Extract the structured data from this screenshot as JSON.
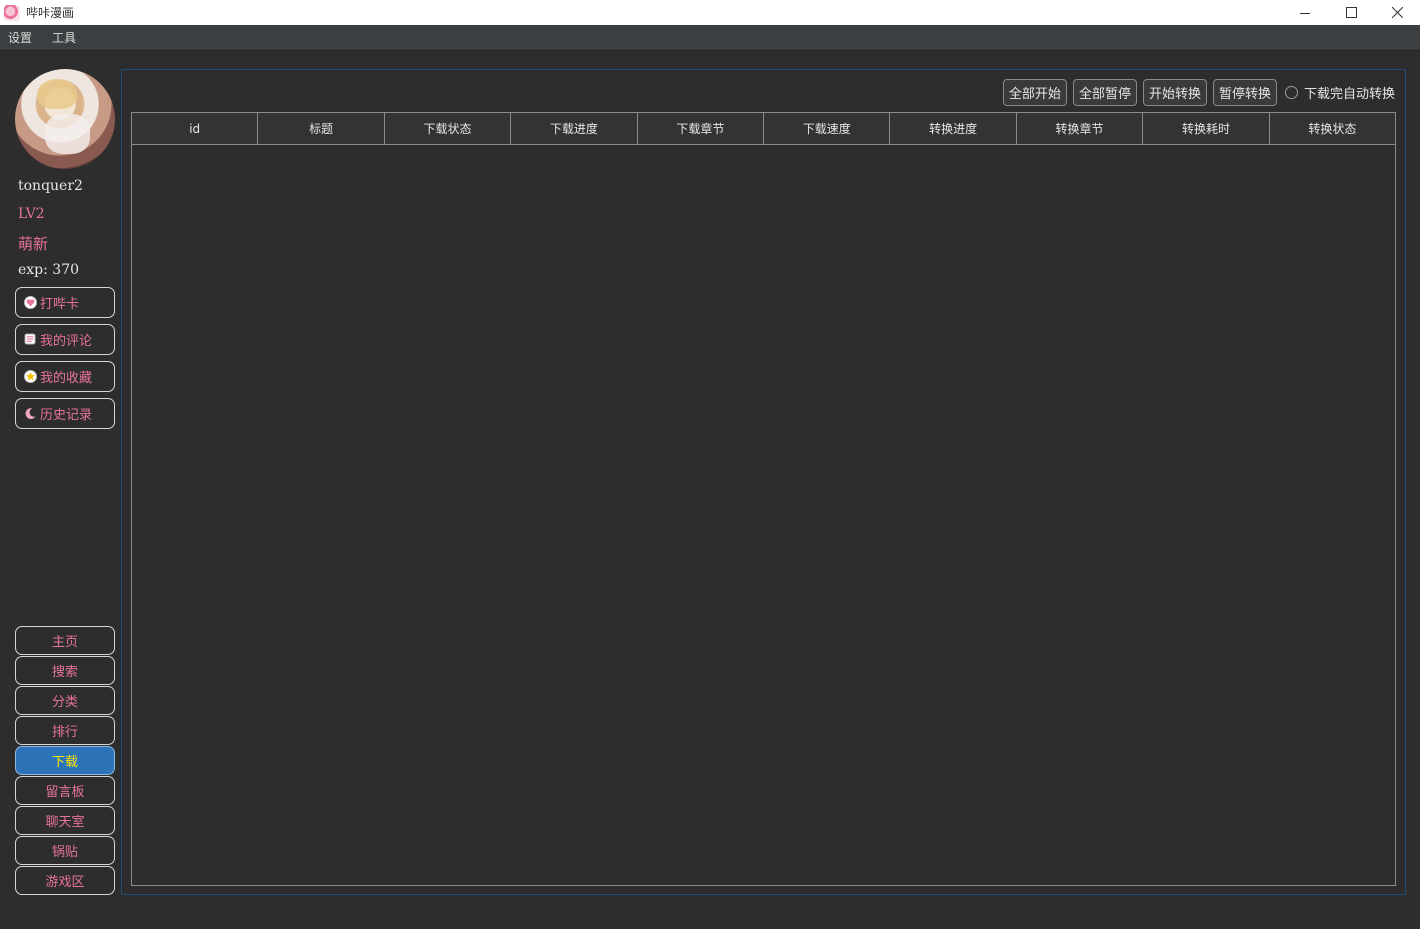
{
  "window": {
    "title": "哔咔漫画"
  },
  "menubar": {
    "items": [
      "设置",
      "工具"
    ]
  },
  "user": {
    "name": "tonquer2",
    "level": "LV2",
    "title": "萌新",
    "exp": "exp: 370"
  },
  "user_actions": [
    {
      "label": "打哔卡",
      "icon": "heart-icon"
    },
    {
      "label": "我的评论",
      "icon": "comment-icon"
    },
    {
      "label": "我的收藏",
      "icon": "star-icon"
    },
    {
      "label": "历史记录",
      "icon": "moon-icon"
    }
  ],
  "nav": [
    {
      "label": "主页"
    },
    {
      "label": "搜索"
    },
    {
      "label": "分类"
    },
    {
      "label": "排行"
    },
    {
      "label": "下载",
      "active": true
    },
    {
      "label": "留言板"
    },
    {
      "label": "聊天室"
    },
    {
      "label": "锅贴"
    },
    {
      "label": "游戏区"
    }
  ],
  "toolbar": {
    "start_all": "全部开始",
    "pause_all": "全部暂停",
    "start_convert": "开始转换",
    "pause_convert": "暂停转换",
    "auto_convert": "下载完自动转换"
  },
  "table": {
    "columns": [
      "id",
      "标题",
      "下载状态",
      "下载进度",
      "下载章节",
      "下载速度",
      "转换进度",
      "转换章节",
      "转换耗时",
      "转换状态"
    ],
    "rows": []
  },
  "colors": {
    "accent_pink": "#e8739b",
    "active_nav": "#2c73b8",
    "active_text": "#ffe600",
    "frame_border": "#1d4e78"
  }
}
